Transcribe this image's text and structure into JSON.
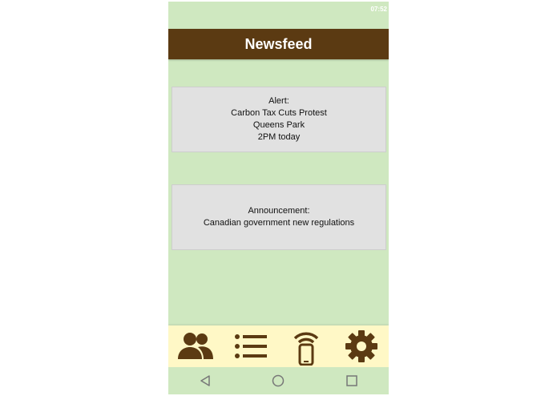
{
  "status_bar": {
    "time": "07:52"
  },
  "header": {
    "title": "Newsfeed"
  },
  "cards": [
    {
      "lines": [
        "Alert:",
        "Carbon Tax Cuts Protest",
        "Queens Park",
        "2PM today"
      ]
    },
    {
      "lines": [
        "Announcement:",
        "Canadian government new regulations"
      ]
    }
  ],
  "bottom_nav": {
    "items": [
      {
        "icon": "people-icon"
      },
      {
        "icon": "list-icon"
      },
      {
        "icon": "phone-signal-icon"
      },
      {
        "icon": "gear-icon"
      }
    ]
  },
  "system_nav": {
    "items": [
      {
        "icon": "back-icon"
      },
      {
        "icon": "home-icon"
      },
      {
        "icon": "recent-apps-icon"
      }
    ]
  },
  "colors": {
    "background": "#cfe8c0",
    "header": "#5b3a12",
    "card": "#e1e1e1",
    "nav": "#fff8c6",
    "icon": "#5b3a12"
  }
}
